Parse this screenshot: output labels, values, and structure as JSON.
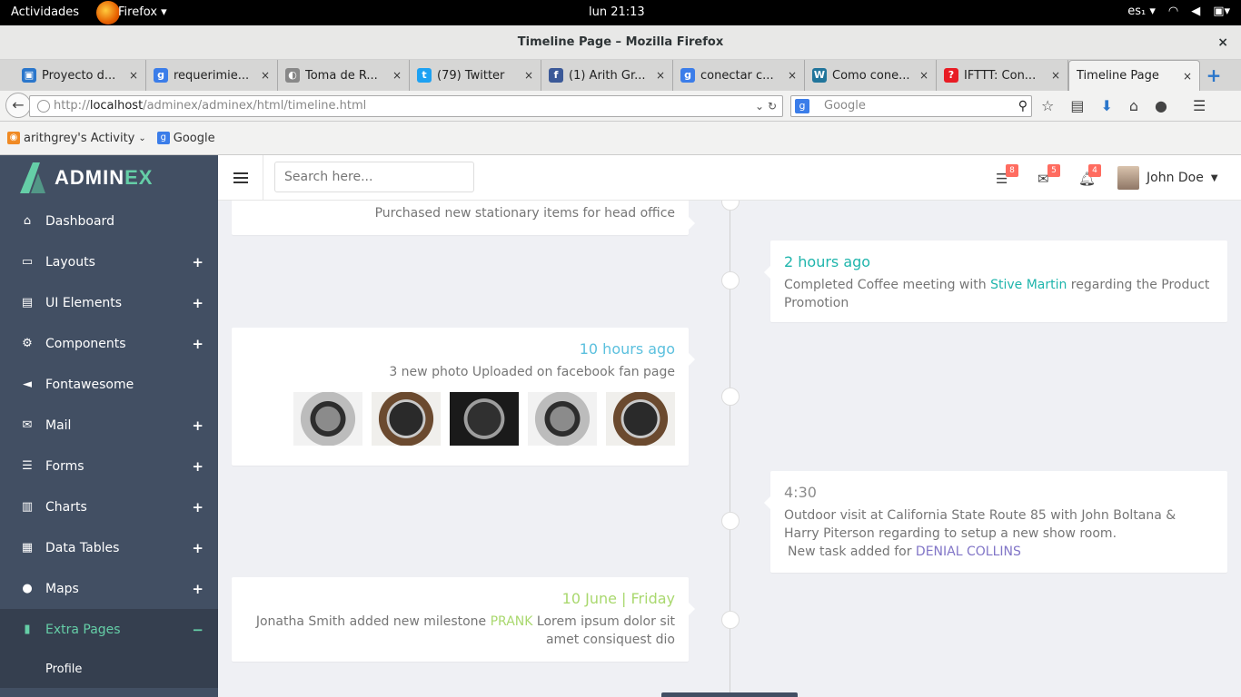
{
  "system": {
    "activities": "Actividades",
    "app_name": "Firefox ▾",
    "clock": "lun 21:13",
    "keyboard": "es₁ ▾"
  },
  "window": {
    "title": "Timeline Page – Mozilla Firefox",
    "close": "×"
  },
  "tabs": [
    {
      "label": "Proyecto d...",
      "icon": "trello-icon",
      "color": "#2a76cb",
      "glyph": "▣"
    },
    {
      "label": "requerimie...",
      "icon": "google-icon",
      "color": "#3b7de9",
      "glyph": "g"
    },
    {
      "label": "Toma de R...",
      "icon": "globe-icon",
      "color": "#888888",
      "glyph": "◐"
    },
    {
      "label": "(79) Twitter",
      "icon": "twitter-icon",
      "color": "#1da1f2",
      "glyph": "t"
    },
    {
      "label": "(1) Arith Gr...",
      "icon": "facebook-icon",
      "color": "#3b5998",
      "glyph": "f"
    },
    {
      "label": "conectar c...",
      "icon": "google-icon",
      "color": "#3b7de9",
      "glyph": "g"
    },
    {
      "label": "Como cone...",
      "icon": "wordpress-icon",
      "color": "#21759b",
      "glyph": "W"
    },
    {
      "label": "IFTTT: Con...",
      "icon": "ifttt-icon",
      "color": "#e81c24",
      "glyph": "?"
    },
    {
      "label": "Timeline Page",
      "icon": "",
      "color": "",
      "glyph": ""
    }
  ],
  "tab_close": "×",
  "new_tab": "+",
  "urlbar": {
    "scheme": "http://",
    "host": "localhost",
    "path": "/adminex/adminex/html/timeline.html"
  },
  "searchbar": {
    "placeholder": "Google"
  },
  "bookmarks": [
    {
      "label": "arithgrey's Activity",
      "icon": "rss-icon",
      "color": "#f08a24",
      "glyph": "◉"
    },
    {
      "label": "Google",
      "icon": "google-icon",
      "color": "#3b7de9",
      "glyph": "g"
    }
  ],
  "brand": {
    "name_main": "ADMIN",
    "name_accent": "EX"
  },
  "sidebar": {
    "items": [
      {
        "label": "Dashboard",
        "icon": "home-icon",
        "glyph": "⌂",
        "expandable": false
      },
      {
        "label": "Layouts",
        "icon": "laptop-icon",
        "glyph": "▭",
        "expandable": true
      },
      {
        "label": "UI Elements",
        "icon": "book-icon",
        "glyph": "▤",
        "expandable": true
      },
      {
        "label": "Components",
        "icon": "cogs-icon",
        "glyph": "⚙",
        "expandable": true
      },
      {
        "label": "Fontawesome",
        "icon": "bullhorn-icon",
        "glyph": "◄",
        "expandable": false
      },
      {
        "label": "Mail",
        "icon": "envelope-icon",
        "glyph": "✉",
        "expandable": true
      },
      {
        "label": "Forms",
        "icon": "tasks-icon",
        "glyph": "☰",
        "expandable": true
      },
      {
        "label": "Charts",
        "icon": "bar-chart-icon",
        "glyph": "▥",
        "expandable": true
      },
      {
        "label": "Data Tables",
        "icon": "table-icon",
        "glyph": "▦",
        "expandable": true
      },
      {
        "label": "Maps",
        "icon": "map-marker-icon",
        "glyph": "●",
        "expandable": true
      },
      {
        "label": "Extra Pages",
        "icon": "file-icon",
        "glyph": "▮",
        "expandable": true,
        "active": true
      }
    ],
    "sub_items": [
      "Profile"
    ],
    "plus": "+",
    "minus": "−"
  },
  "header": {
    "search_placeholder": "Search here...",
    "badges": {
      "tasks": "8",
      "mail": "5",
      "notifications": "4"
    },
    "user_name": "John Doe"
  },
  "timeline": {
    "item1": {
      "text": "Purchased new stationary items for head office"
    },
    "item2": {
      "time": "2 hours ago",
      "text_before": "Completed Coffee meeting with ",
      "link": "Stive Martin",
      "text_after": " regarding the Product Promotion"
    },
    "item3": {
      "time": "10 hours ago",
      "text": "3 new photo Uploaded on facebook fan page"
    },
    "item4": {
      "time": "4:30",
      "text": "Outdoor visit at California State Route 85 with John Boltana & Harry Piterson regarding to setup a new show room.",
      "task_prefix": "New task added for ",
      "task_link": "DENIAL COLLINS"
    },
    "item5": {
      "time": "10 June | Friday",
      "text_before": "Jonatha Smith added new milestone ",
      "link": "PRANK",
      "text_after": " Lorem ipsum dolor sit amet consiquest dio"
    }
  },
  "colors": {
    "sidebar_bg": "#424f63",
    "accent": "#65cea7",
    "badge": "#ff6c60"
  }
}
